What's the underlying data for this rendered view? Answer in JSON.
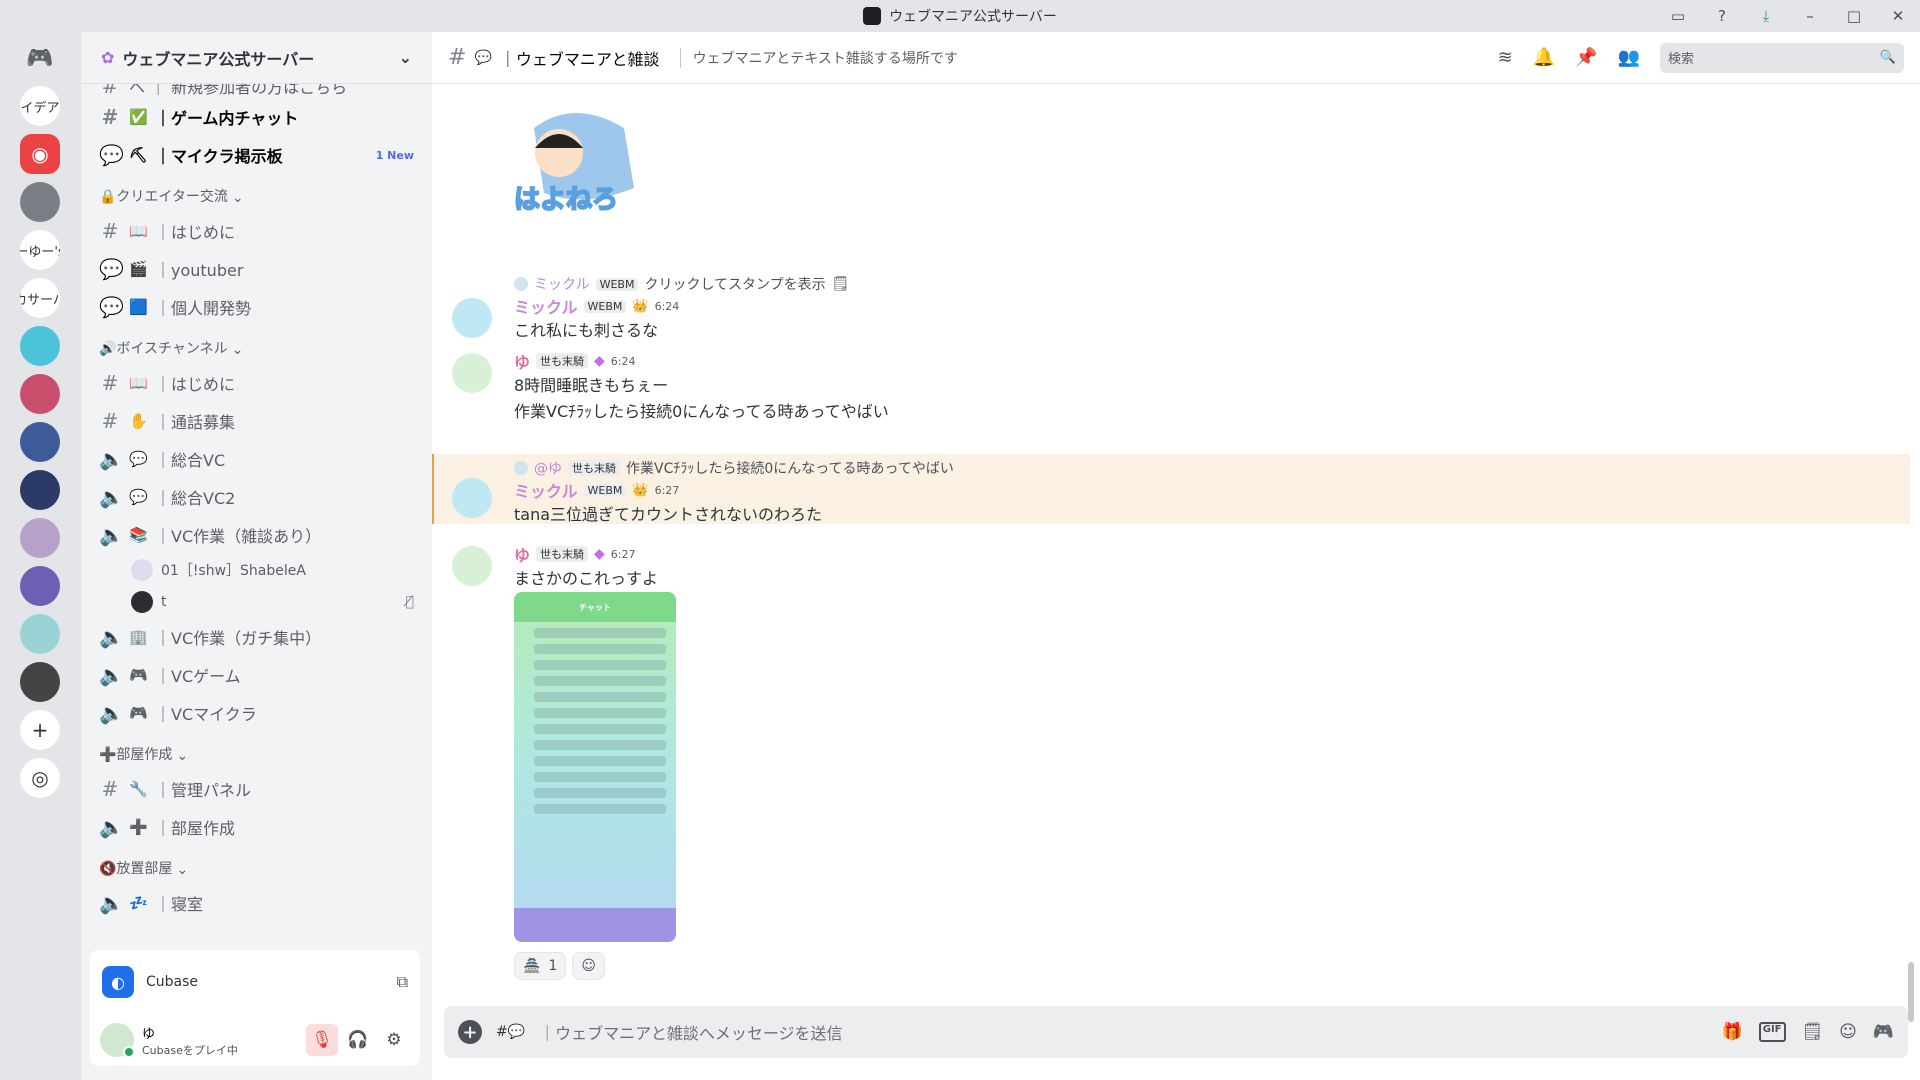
{
  "window": {
    "title": "ウェブマニア公式サーバー"
  },
  "rail": {
    "items": [
      "イデア",
      "ーゆー's",
      "カサーバ"
    ]
  },
  "server": {
    "name": "ウェブマニア公式サーバー"
  },
  "channels": {
    "partial_top": "ヘ ｜ 新規参加者の方はこちら",
    "items": [
      {
        "type": "text",
        "emoji": "✅",
        "label": "｜ゲーム内チャット",
        "unread": true
      },
      {
        "type": "forum",
        "emoji": "⛏",
        "label": "｜マイクラ掲示板",
        "unread": true,
        "badge": "1 New"
      }
    ],
    "categories": [
      {
        "name": "🔒クリエイター交流",
        "items": [
          {
            "type": "text",
            "emoji": "📖",
            "label": "｜はじめに"
          },
          {
            "type": "forum",
            "emoji": "🎬",
            "label": "｜youtuber"
          },
          {
            "type": "forum",
            "emoji": "🟦",
            "label": "｜個人開発勢"
          }
        ]
      },
      {
        "name": "🔊ボイスチャンネル",
        "items": [
          {
            "type": "text",
            "emoji": "📖",
            "label": "｜はじめに"
          },
          {
            "type": "text",
            "emoji": "✋",
            "label": "｜通話募集"
          },
          {
            "type": "voice",
            "emoji": "💬",
            "label": "｜総合VC"
          },
          {
            "type": "voice",
            "emoji": "💬",
            "label": "｜総合VC2"
          },
          {
            "type": "voice",
            "emoji": "📚",
            "label": "｜VC作業（雑談あり）"
          }
        ],
        "voice_users": [
          "01［!shw］ShabeleA",
          "t"
        ]
      },
      {
        "name": "",
        "items": [
          {
            "type": "voice",
            "emoji": "🏢",
            "label": "｜VC作業（ガチ集中）"
          },
          {
            "type": "voice",
            "emoji": "🎮",
            "label": "｜VCゲーム"
          },
          {
            "type": "voice",
            "emoji": "🎮",
            "label": "｜VCマイクラ"
          }
        ]
      },
      {
        "name": "➕部屋作成",
        "items": [
          {
            "type": "text",
            "emoji": "🔧",
            "label": "｜管理パネル"
          },
          {
            "type": "voice",
            "emoji": "➕",
            "label": "｜部屋作成"
          }
        ]
      },
      {
        "name": "🔇放置部屋",
        "items": [
          {
            "type": "voice",
            "emoji": "💤",
            "label": "｜寝室"
          }
        ]
      }
    ]
  },
  "activity": {
    "name": "Cubase"
  },
  "user": {
    "name": "ゆ",
    "status": "Cubaseをプレイ中"
  },
  "chat": {
    "channel_name": "｜ウェブマニアと雑談",
    "topic": "ウェブマニアとテキスト雑談する場所です",
    "search_placeholder": "検索",
    "sticker_text": "はよねろ",
    "messages": [
      {
        "reply": {
          "name": "ミックル",
          "tag": "WEBM",
          "text": "クリックしてスタンプを表示"
        },
        "author": "ミックル",
        "tag": "WEBM",
        "time": "6:24",
        "lines": [
          "これ私にも刺さるな"
        ]
      },
      {
        "author": "ゆ",
        "tag": "世も末騎",
        "time": "6:24",
        "lines": [
          "8時間睡眠きもちぇー",
          "作業VCﾁﾗｯしたら接続0にんなってる時あってやばい"
        ]
      },
      {
        "reply": {
          "name": "@ゆ",
          "tag": "世も末騎",
          "text": "作業VCﾁﾗｯしたら接続0にんなってる時あってやばい"
        },
        "author": "ミックル",
        "tag": "WEBM",
        "time": "6:27",
        "lines": [
          "tana三位過ぎてカウントされないのわろた"
        ]
      },
      {
        "author": "ゆ",
        "tag": "世も末騎",
        "time": "6:27",
        "lines": [
          "まさかのこれっすよ"
        ],
        "attachment_title": "チャット",
        "reactions": [
          {
            "emoji": "🏯",
            "count": "1"
          }
        ]
      }
    ],
    "composer_placeholder": "｜ウェブマニアと雑談へメッセージを送信"
  }
}
